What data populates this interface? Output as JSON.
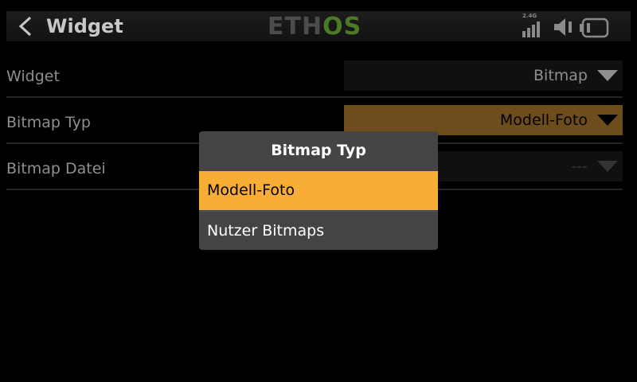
{
  "header": {
    "title": "Widget",
    "logo": {
      "prefix": "ETH",
      "suffix": "OS"
    },
    "signal_band": "2.4G",
    "icons": [
      "back-arrow-icon",
      "signal-icon",
      "speaker-icon",
      "battery-icon"
    ]
  },
  "settings": {
    "rows": [
      {
        "label": "Widget",
        "value": "Bitmap"
      },
      {
        "label": "Bitmap Typ",
        "value": "Modell-Foto"
      },
      {
        "label": "Bitmap Datei",
        "value": "---"
      }
    ]
  },
  "popup": {
    "title": "Bitmap Typ",
    "options": [
      {
        "label": "Modell-Foto",
        "selected": true
      },
      {
        "label": "Nutzer Bitmaps",
        "selected": false
      }
    ]
  },
  "colors": {
    "accent": "#f8ae36",
    "selected_field": "#6d4d1c",
    "logo_green": "#4e7a25",
    "background": "#000000",
    "popup_background": "#444444"
  }
}
